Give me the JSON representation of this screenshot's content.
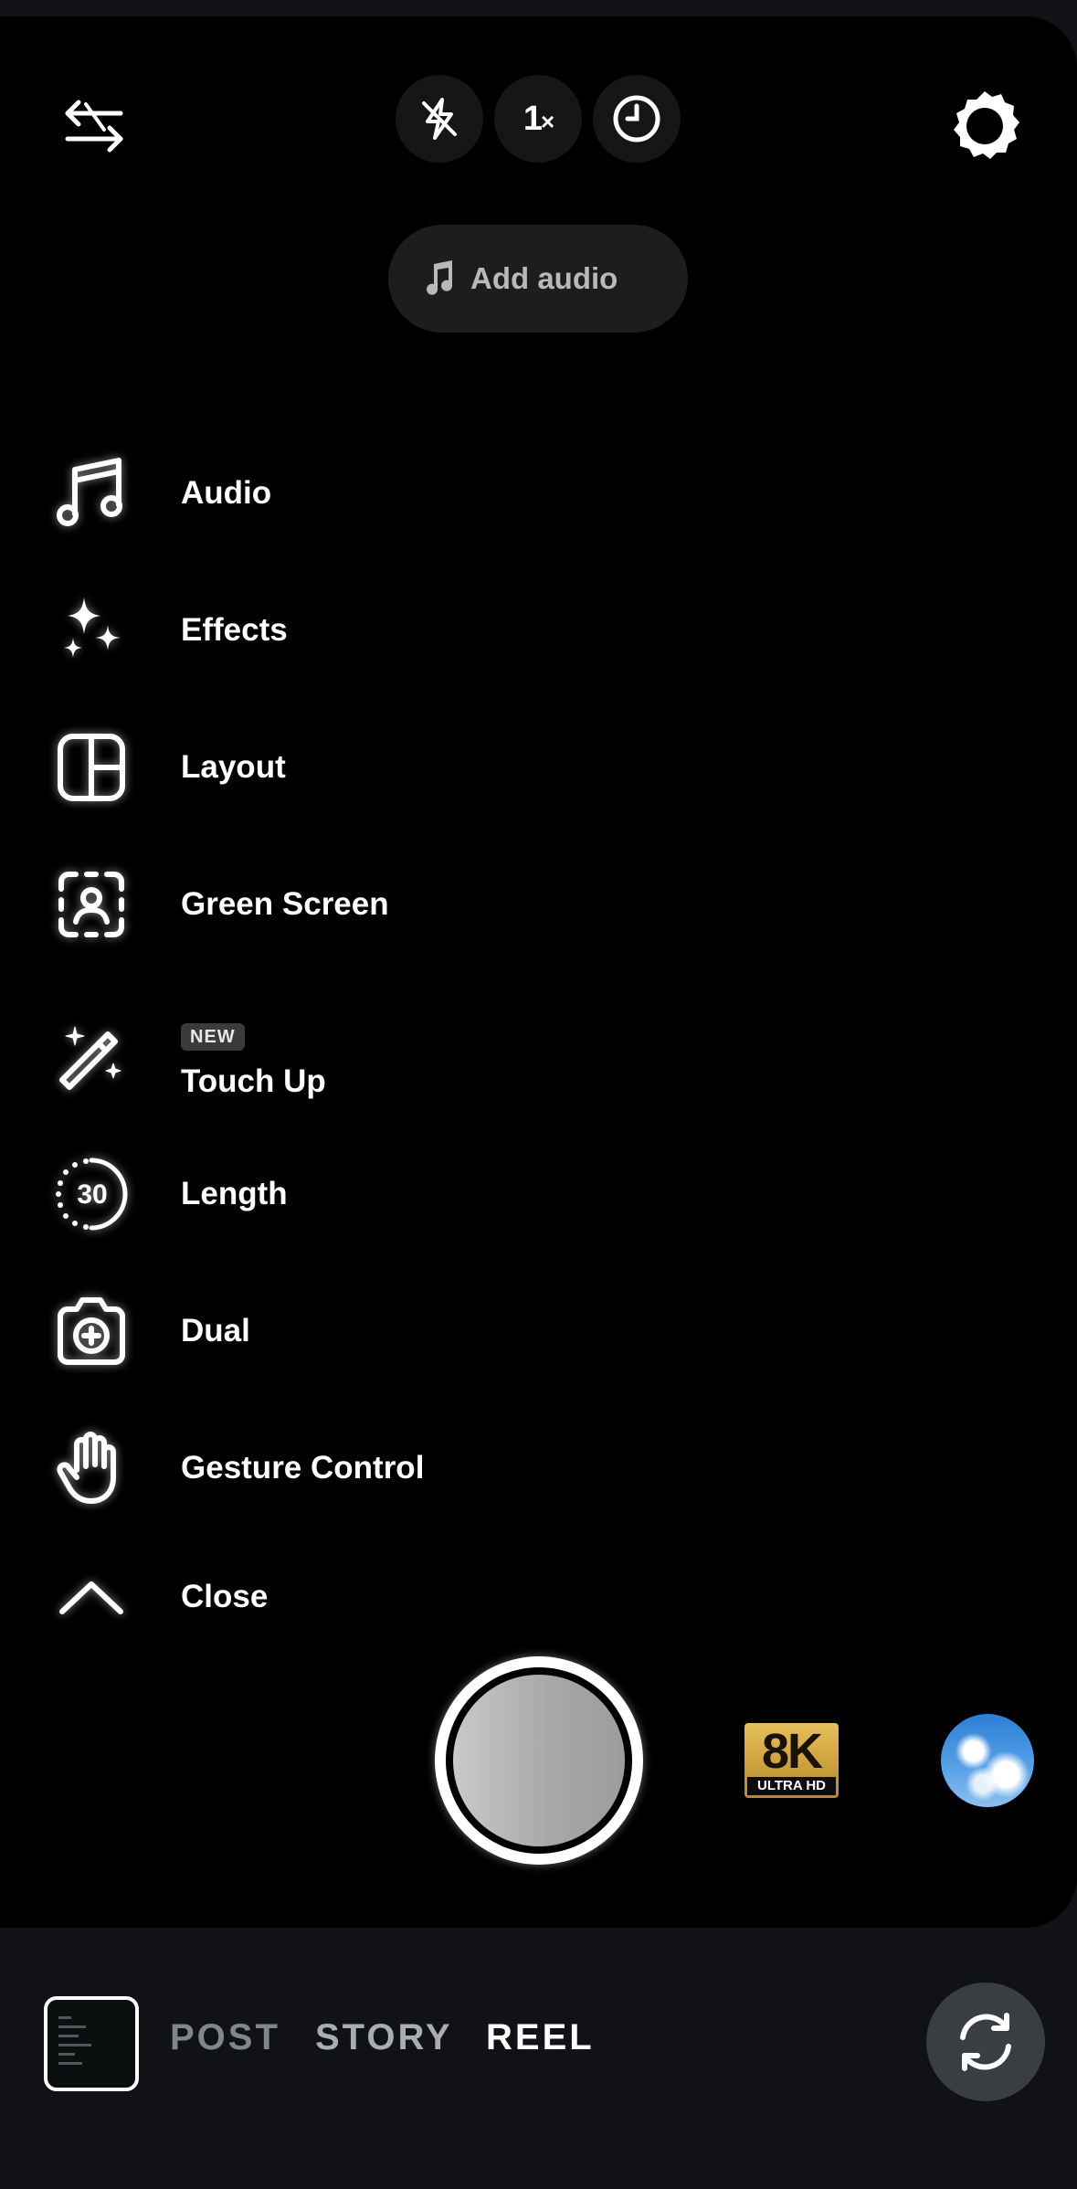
{
  "camera": {
    "zoom_label": "1",
    "zoom_suffix": "×",
    "add_audio_label": "Add audio"
  },
  "menu": {
    "items": [
      {
        "label": "Audio",
        "icon": "music-note-icon"
      },
      {
        "label": "Effects",
        "icon": "sparkles-icon"
      },
      {
        "label": "Layout",
        "icon": "layout-grid-icon"
      },
      {
        "label": "Green Screen",
        "icon": "green-screen-icon"
      },
      {
        "label": "Touch Up",
        "icon": "magic-wand-icon",
        "badge": "NEW"
      },
      {
        "label": "Length",
        "icon": "timer-length-icon",
        "value": "30"
      },
      {
        "label": "Dual",
        "icon": "dual-camera-icon"
      },
      {
        "label": "Gesture Control",
        "icon": "hand-icon"
      },
      {
        "label": "Close",
        "icon": "chevron-up-icon"
      }
    ]
  },
  "capture": {
    "badge_main": "8K",
    "badge_sub": "ULTRA HD"
  },
  "modes": {
    "post": "POST",
    "story": "STORY",
    "reel": "REEL",
    "active": "REEL"
  },
  "colors": {
    "background": "#000000",
    "bottom_bar": "#101217",
    "active_mode": "#ffffff",
    "inactive_mode": "#a9acb1"
  }
}
